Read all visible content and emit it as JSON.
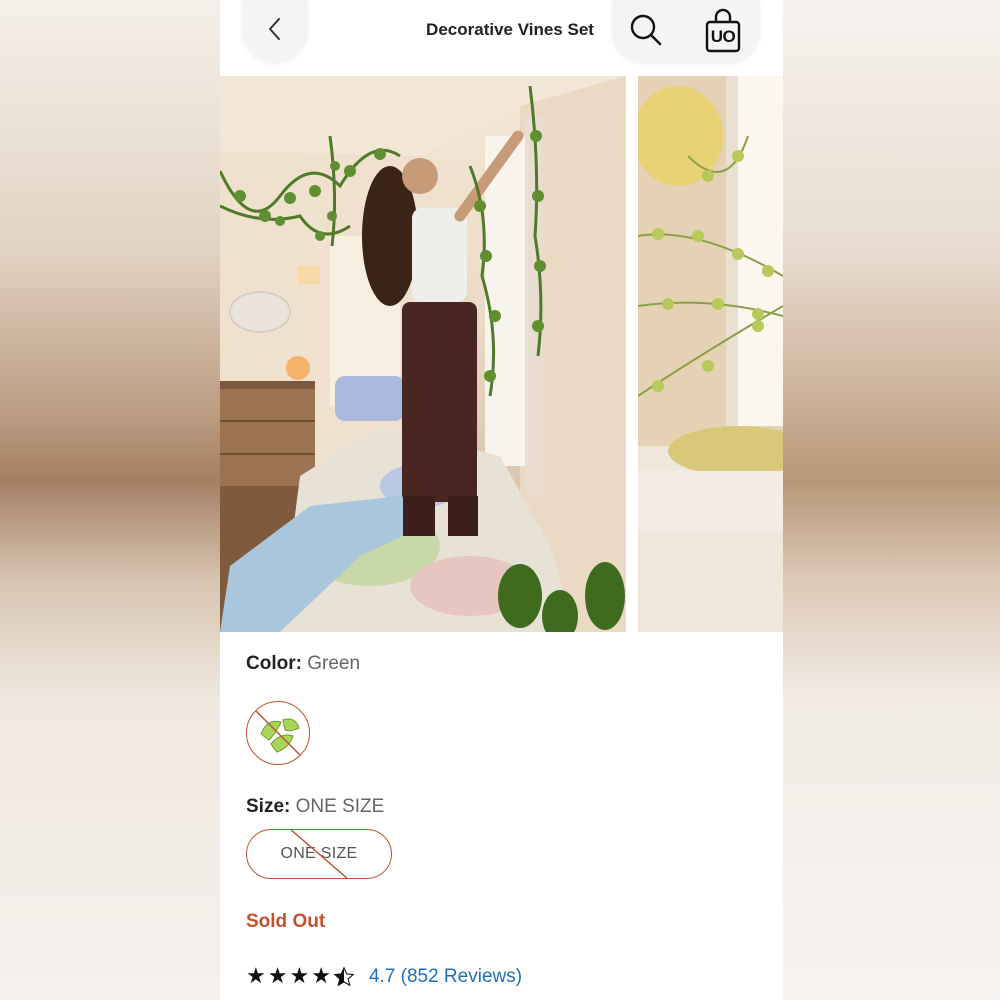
{
  "header": {
    "title": "Decorative Vines Set",
    "back_icon": "chevron-left-icon",
    "search_icon": "search-icon",
    "bag_icon": "shopping-bag-icon",
    "bag_logo": "UO"
  },
  "gallery": {
    "images": [
      {
        "description": "bedroom with decorative vines"
      },
      {
        "description": "vines over bed"
      }
    ]
  },
  "color": {
    "label": "Color:",
    "value": "Green",
    "swatch_state": "unavailable"
  },
  "size": {
    "label": "Size:",
    "value": "ONE SIZE",
    "option_label": "ONE SIZE",
    "option_state": "unavailable"
  },
  "status": {
    "text": "Sold Out",
    "color": "#c2522e"
  },
  "rating": {
    "value": 4.7,
    "text": "4.7 (852 Reviews)",
    "stars_filled": 4.5,
    "link_color": "#1f6fbf"
  }
}
